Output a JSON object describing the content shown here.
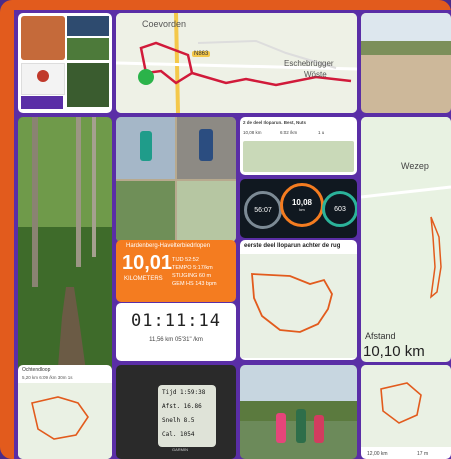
{
  "tiles": {
    "t2": {
      "place_1": "Coevorden",
      "road": "N863",
      "place_2": "Esche",
      "place_3": "brügger",
      "place_4": "Wöste"
    },
    "t6": {
      "row1": "2 de deel Iloparun. Best, Nuts",
      "row2a": "10,08 km",
      "row2b": "6:02 /km",
      "row2c": "1 u"
    },
    "t7": {
      "ring_left": "56:07",
      "ring_center": "10,08",
      "ring_center_sub": "km",
      "ring_right": "603"
    },
    "t8": {
      "place": "Wezep",
      "label": "Afstand",
      "value": "10,10 km"
    },
    "t9": {
      "title": "Hardenberg-Havelterbiedrlopen",
      "distance": "10,01",
      "unit": "KILOMETERS",
      "stats": [
        "TIJD 52:52",
        "TEMPO 5:17/km",
        "STIJGING 60 m",
        "GEM HS 143 bpm"
      ]
    },
    "t10": {
      "title": "eerste deel Iloparun achter de rug"
    },
    "t11": {
      "time": "01:11:14",
      "sub": "11,56 km   05'31\" /km"
    },
    "t12": {
      "title": "Ochtendloop",
      "stats": "5,20 km   6:09 /km   30m 1s"
    },
    "t13": {
      "rows": [
        "Tijd  1:59:38",
        "Afst.  16.86",
        "Snelh  8.5",
        "Cal.  1054"
      ],
      "brand": "GARMIN"
    },
    "t15": {
      "stat_1": "12,00 km",
      "stat_2": "17 m"
    }
  }
}
